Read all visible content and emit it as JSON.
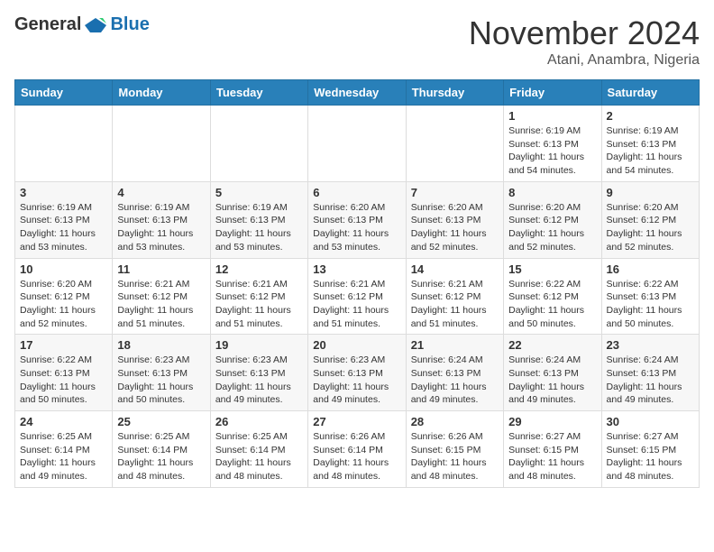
{
  "header": {
    "logo_general": "General",
    "logo_blue": "Blue",
    "month_title": "November 2024",
    "location": "Atani, Anambra, Nigeria"
  },
  "weekdays": [
    "Sunday",
    "Monday",
    "Tuesday",
    "Wednesday",
    "Thursday",
    "Friday",
    "Saturday"
  ],
  "weeks": [
    [
      {
        "day": "",
        "info": ""
      },
      {
        "day": "",
        "info": ""
      },
      {
        "day": "",
        "info": ""
      },
      {
        "day": "",
        "info": ""
      },
      {
        "day": "",
        "info": ""
      },
      {
        "day": "1",
        "info": "Sunrise: 6:19 AM\nSunset: 6:13 PM\nDaylight: 11 hours\nand 54 minutes."
      },
      {
        "day": "2",
        "info": "Sunrise: 6:19 AM\nSunset: 6:13 PM\nDaylight: 11 hours\nand 54 minutes."
      }
    ],
    [
      {
        "day": "3",
        "info": "Sunrise: 6:19 AM\nSunset: 6:13 PM\nDaylight: 11 hours\nand 53 minutes."
      },
      {
        "day": "4",
        "info": "Sunrise: 6:19 AM\nSunset: 6:13 PM\nDaylight: 11 hours\nand 53 minutes."
      },
      {
        "day": "5",
        "info": "Sunrise: 6:19 AM\nSunset: 6:13 PM\nDaylight: 11 hours\nand 53 minutes."
      },
      {
        "day": "6",
        "info": "Sunrise: 6:20 AM\nSunset: 6:13 PM\nDaylight: 11 hours\nand 53 minutes."
      },
      {
        "day": "7",
        "info": "Sunrise: 6:20 AM\nSunset: 6:13 PM\nDaylight: 11 hours\nand 52 minutes."
      },
      {
        "day": "8",
        "info": "Sunrise: 6:20 AM\nSunset: 6:12 PM\nDaylight: 11 hours\nand 52 minutes."
      },
      {
        "day": "9",
        "info": "Sunrise: 6:20 AM\nSunset: 6:12 PM\nDaylight: 11 hours\nand 52 minutes."
      }
    ],
    [
      {
        "day": "10",
        "info": "Sunrise: 6:20 AM\nSunset: 6:12 PM\nDaylight: 11 hours\nand 52 minutes."
      },
      {
        "day": "11",
        "info": "Sunrise: 6:21 AM\nSunset: 6:12 PM\nDaylight: 11 hours\nand 51 minutes."
      },
      {
        "day": "12",
        "info": "Sunrise: 6:21 AM\nSunset: 6:12 PM\nDaylight: 11 hours\nand 51 minutes."
      },
      {
        "day": "13",
        "info": "Sunrise: 6:21 AM\nSunset: 6:12 PM\nDaylight: 11 hours\nand 51 minutes."
      },
      {
        "day": "14",
        "info": "Sunrise: 6:21 AM\nSunset: 6:12 PM\nDaylight: 11 hours\nand 51 minutes."
      },
      {
        "day": "15",
        "info": "Sunrise: 6:22 AM\nSunset: 6:12 PM\nDaylight: 11 hours\nand 50 minutes."
      },
      {
        "day": "16",
        "info": "Sunrise: 6:22 AM\nSunset: 6:13 PM\nDaylight: 11 hours\nand 50 minutes."
      }
    ],
    [
      {
        "day": "17",
        "info": "Sunrise: 6:22 AM\nSunset: 6:13 PM\nDaylight: 11 hours\nand 50 minutes."
      },
      {
        "day": "18",
        "info": "Sunrise: 6:23 AM\nSunset: 6:13 PM\nDaylight: 11 hours\nand 50 minutes."
      },
      {
        "day": "19",
        "info": "Sunrise: 6:23 AM\nSunset: 6:13 PM\nDaylight: 11 hours\nand 49 minutes."
      },
      {
        "day": "20",
        "info": "Sunrise: 6:23 AM\nSunset: 6:13 PM\nDaylight: 11 hours\nand 49 minutes."
      },
      {
        "day": "21",
        "info": "Sunrise: 6:24 AM\nSunset: 6:13 PM\nDaylight: 11 hours\nand 49 minutes."
      },
      {
        "day": "22",
        "info": "Sunrise: 6:24 AM\nSunset: 6:13 PM\nDaylight: 11 hours\nand 49 minutes."
      },
      {
        "day": "23",
        "info": "Sunrise: 6:24 AM\nSunset: 6:13 PM\nDaylight: 11 hours\nand 49 minutes."
      }
    ],
    [
      {
        "day": "24",
        "info": "Sunrise: 6:25 AM\nSunset: 6:14 PM\nDaylight: 11 hours\nand 49 minutes."
      },
      {
        "day": "25",
        "info": "Sunrise: 6:25 AM\nSunset: 6:14 PM\nDaylight: 11 hours\nand 48 minutes."
      },
      {
        "day": "26",
        "info": "Sunrise: 6:25 AM\nSunset: 6:14 PM\nDaylight: 11 hours\nand 48 minutes."
      },
      {
        "day": "27",
        "info": "Sunrise: 6:26 AM\nSunset: 6:14 PM\nDaylight: 11 hours\nand 48 minutes."
      },
      {
        "day": "28",
        "info": "Sunrise: 6:26 AM\nSunset: 6:15 PM\nDaylight: 11 hours\nand 48 minutes."
      },
      {
        "day": "29",
        "info": "Sunrise: 6:27 AM\nSunset: 6:15 PM\nDaylight: 11 hours\nand 48 minutes."
      },
      {
        "day": "30",
        "info": "Sunrise: 6:27 AM\nSunset: 6:15 PM\nDaylight: 11 hours\nand 48 minutes."
      }
    ]
  ]
}
